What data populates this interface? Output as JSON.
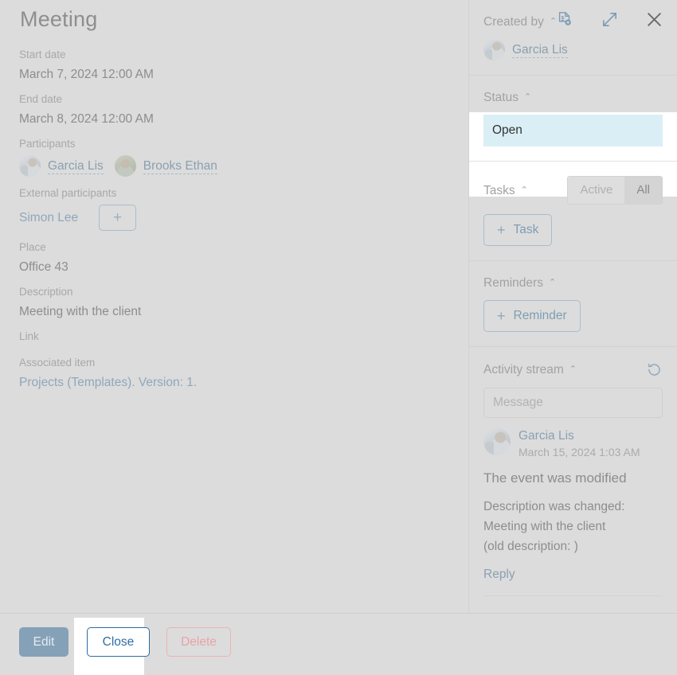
{
  "header": {
    "title": "Meeting",
    "icons": [
      {
        "name": "report-document-icon",
        "label": "Report"
      },
      {
        "name": "expand-diagonal-icon",
        "label": "Expand"
      },
      {
        "name": "close-x-icon",
        "label": "Close"
      }
    ]
  },
  "main": {
    "fields": [
      {
        "label": "Start date",
        "value": "March 7, 2024 12:00 AM"
      },
      {
        "label": "End date",
        "value": "March 8, 2024 12:00 AM"
      }
    ],
    "participants": {
      "label": "Participants",
      "people": [
        {
          "name": "Garcia Lis"
        },
        {
          "name": "Brooks Ethan"
        }
      ]
    },
    "external_participants": {
      "label": "External participants",
      "people": [
        {
          "name": "Simon Lee"
        }
      ],
      "add_button": "+"
    },
    "place": {
      "label": "Place",
      "value": "Office 43"
    },
    "description": {
      "label": "Description",
      "value": "Meeting with the client"
    },
    "link": {
      "label": "Link",
      "value": ""
    },
    "associated_item": {
      "label": "Associated item",
      "value": "Projects (Templates). Version: 1."
    }
  },
  "footer": {
    "edit_label": "Edit",
    "close_label": "Close",
    "delete_label": "Delete"
  },
  "sidebar": {
    "created_by": {
      "title": "Created by",
      "caret": "⌃",
      "user": "Garcia Lis"
    },
    "status": {
      "title": "Status",
      "caret": "⌃",
      "value": "Open",
      "highlight_color": "#daeef5"
    },
    "tasks": {
      "title": "Tasks",
      "caret": "⌃",
      "filters": [
        {
          "label": "Active",
          "selected": false
        },
        {
          "label": "All",
          "selected": true
        }
      ],
      "add_button": "Task",
      "plus": "+"
    },
    "reminders": {
      "title": "Reminders",
      "caret": "⌃",
      "add_button": "Reminder",
      "plus": "+"
    },
    "activity_stream": {
      "title": "Activity stream",
      "caret": "⌃",
      "refresh_icon": "refresh-icon",
      "message_placeholder": "Message",
      "message_value": "",
      "entries": [
        {
          "author": "Garcia Lis",
          "timestamp": "March 15, 2024 1:03 AM",
          "headline": "The event was modified",
          "body_line1": "Description was changed:",
          "body_line2": "Meeting with the client",
          "body_line3": "(old description: )",
          "reply_label": "Reply"
        }
      ]
    }
  }
}
